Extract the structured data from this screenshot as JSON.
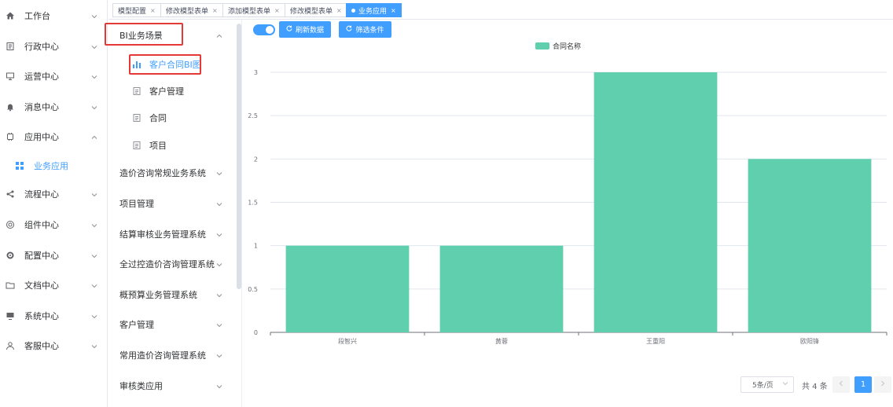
{
  "sidebar": {
    "items": [
      {
        "label": "工作台",
        "icon": "home-icon"
      },
      {
        "label": "行政中心",
        "icon": "document-icon"
      },
      {
        "label": "运营中心",
        "icon": "presentation-icon"
      },
      {
        "label": "消息中心",
        "icon": "bell-icon"
      },
      {
        "label": "应用中心",
        "icon": "chip-icon"
      },
      {
        "label": "业务应用",
        "icon": "grid-icon"
      },
      {
        "label": "流程中心",
        "icon": "share-icon"
      },
      {
        "label": "组件中心",
        "icon": "component-icon"
      },
      {
        "label": "配置中心",
        "icon": "gear-icon"
      },
      {
        "label": "文档中心",
        "icon": "folder-icon"
      },
      {
        "label": "系统中心",
        "icon": "monitor-icon"
      },
      {
        "label": "客服中心",
        "icon": "user-icon"
      }
    ]
  },
  "tabs": [
    {
      "label": "模型配置"
    },
    {
      "label": "修改模型表单"
    },
    {
      "label": "添加模型表单"
    },
    {
      "label": "修改模型表单"
    },
    {
      "label": "业务应用"
    }
  ],
  "panel": {
    "group_title": "BI业务场景",
    "sub_items": [
      {
        "label": "客户合同BI图",
        "icon": "bar-chart-icon"
      },
      {
        "label": "客户管理",
        "icon": "file-icon"
      },
      {
        "label": "合同",
        "icon": "file-icon"
      },
      {
        "label": "项目",
        "icon": "file-icon"
      }
    ],
    "groups": [
      {
        "label": "造价咨询常规业务系统"
      },
      {
        "label": "项目管理"
      },
      {
        "label": "结算审核业务管理系统"
      },
      {
        "label": "全过控造价咨询管理系统"
      },
      {
        "label": "概预算业务管理系统"
      },
      {
        "label": "客户管理"
      },
      {
        "label": "常用造价咨询管理系统"
      },
      {
        "label": "审核类应用"
      }
    ]
  },
  "toolbar": {
    "refresh_label": "刷新数据",
    "filter_label": "筛选条件"
  },
  "pagination": {
    "page_size": "5条/页",
    "total": "共 4 条",
    "current_page": "1"
  },
  "colors": {
    "primary": "#409eff",
    "bar": "#5fcfad",
    "highlight": "#e53935"
  },
  "chart_data": {
    "type": "bar",
    "categories": [
      "段智兴",
      "黄蓉",
      "王重阳",
      "欧阳锋"
    ],
    "series": [
      {
        "name": "合同名称",
        "values": [
          1,
          1,
          3,
          2
        ]
      }
    ],
    "yticks": [
      "0",
      "0.5",
      "1",
      "1.5",
      "2",
      "2.5",
      "3"
    ],
    "ylim": [
      0,
      3
    ],
    "legend": "top-center",
    "grid": true
  }
}
